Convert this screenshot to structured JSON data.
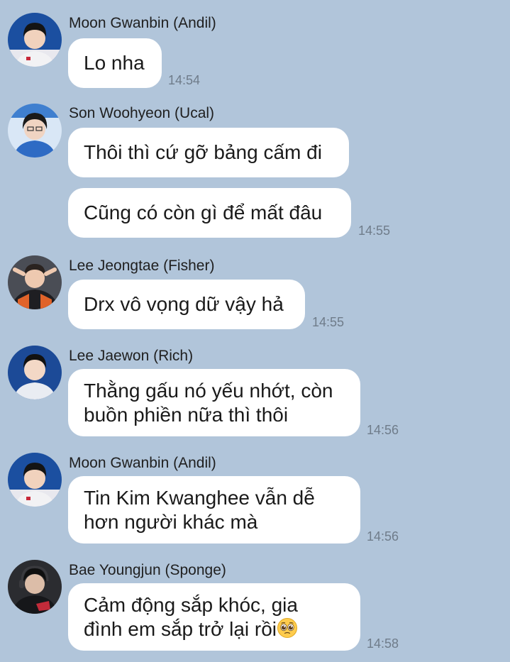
{
  "messages": [
    {
      "sender": "Moon Gwanbin (Andil)",
      "bubbles": [
        {
          "lines": [
            "Lo nha"
          ]
        }
      ],
      "time": "14:54"
    },
    {
      "sender": "Son Woohyeon (Ucal)",
      "bubbles": [
        {
          "lines": [
            "Thôi thì cứ gỡ bảng cấm đi"
          ]
        },
        {
          "lines": [
            "Cũng có còn gì để mất đâu"
          ]
        }
      ],
      "time": "14:55"
    },
    {
      "sender": "Lee Jeongtae (Fisher)",
      "bubbles": [
        {
          "lines": [
            "Drx vô vọng dữ vậy hả"
          ]
        }
      ],
      "time": "14:55"
    },
    {
      "sender": "Lee Jaewon (Rich)",
      "bubbles": [
        {
          "lines": [
            "Thằng gấu nó yếu nhớt, còn",
            "buồn phiền nữa thì thôi"
          ]
        }
      ],
      "time": "14:56"
    },
    {
      "sender": "Moon Gwanbin (Andil)",
      "bubbles": [
        {
          "lines": [
            "Tin Kim Kwanghee vẫn dễ",
            "hơn người khác mà"
          ]
        }
      ],
      "time": "14:56"
    },
    {
      "sender": "Bae Youngjun (Sponge)",
      "bubbles": [
        {
          "lines": [
            "Cảm động sắp khóc, gia",
            "đình em sắp trở lại rồi"
          ],
          "trailing_icon": "pleading-face-emoji-icon"
        }
      ],
      "time": "14:58"
    }
  ],
  "colors": {
    "background": "#b1c5da",
    "bubble": "#ffffff",
    "timestamp": "#6f7c8a"
  }
}
